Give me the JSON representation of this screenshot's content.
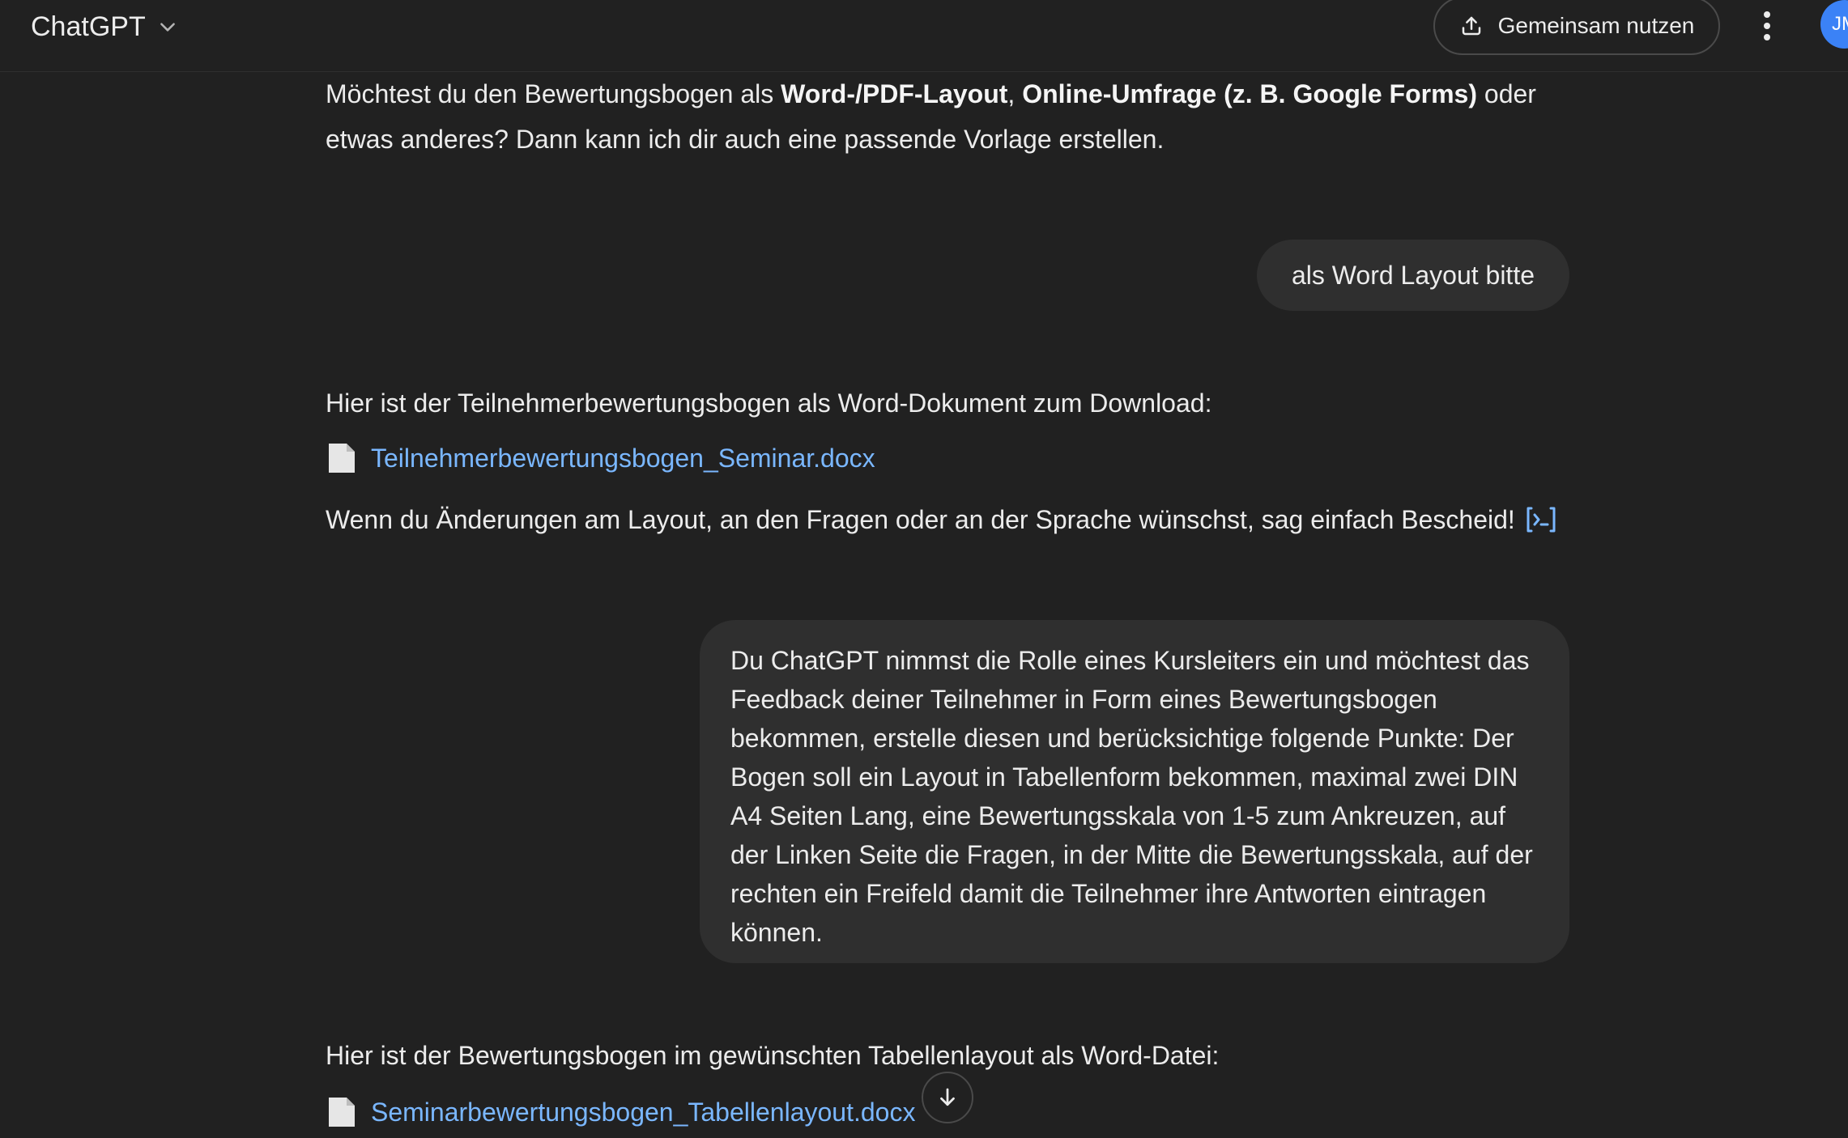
{
  "header": {
    "app_title": "ChatGPT",
    "share_label": "Gemeinsam nutzen",
    "avatar_initials": "JM"
  },
  "messages": [
    {
      "role": "assistant",
      "segments": [
        {
          "text": "Möchtest du den Bewertungsbogen als ",
          "bold": false
        },
        {
          "text": "Word-/PDF-Layout",
          "bold": true
        },
        {
          "text": ", ",
          "bold": false
        },
        {
          "text": "Online-Umfrage (z. B. Google Forms)",
          "bold": true
        },
        {
          "text": " oder etwas anderes? Dann kann ich dir auch eine passende Vorlage erstellen.",
          "bold": false
        }
      ]
    },
    {
      "role": "user",
      "text": "als Word Layout bitte"
    },
    {
      "role": "assistant",
      "intro": "Hier ist der Teilnehmerbewertungsbogen als Word-Dokument zum Download:",
      "file_link": "Teilnehmerbewertungsbogen_Seminar.docx",
      "outro": "Wenn du Änderungen am Layout, an den Fragen oder an der Sprache wünschst, sag einfach Bescheid!"
    },
    {
      "role": "user",
      "text": "Du ChatGPT nimmst die Rolle eines Kursleiters ein und möchtest das Feedback deiner Teilnehmer in Form eines Bewertungsbogen bekommen, erstelle diesen und berücksichtige folgende Punkte: Der Bogen soll ein Layout in Tabellenform bekommen, maximal zwei DIN A4 Seiten Lang, eine Bewertungsskala von 1-5 zum Ankreuzen, auf der Linken Seite die Fragen, in der Mitte die Bewertungsskala, auf der rechten ein Freifeld damit die Teilnehmer ihre Antworten eintragen können."
    },
    {
      "role": "assistant",
      "intro": "Hier ist der Bewertungsbogen im gewünschten Tabellenlayout als Word-Datei:",
      "file_link": "Seminarbewertungsbogen_Tabellenlayout.docx"
    }
  ],
  "icons": {
    "brand_chevron": "chevron-down-icon",
    "share": "upload-icon",
    "more": "more-vertical-icon",
    "code": "code-interpreter-icon",
    "document": "document-icon",
    "scroll": "arrow-down-icon"
  },
  "colors": {
    "background": "#212121",
    "bubble": "#2f2f2f",
    "link": "#7ab7ff",
    "avatar": "#3b82f6",
    "text": "#ececec"
  }
}
